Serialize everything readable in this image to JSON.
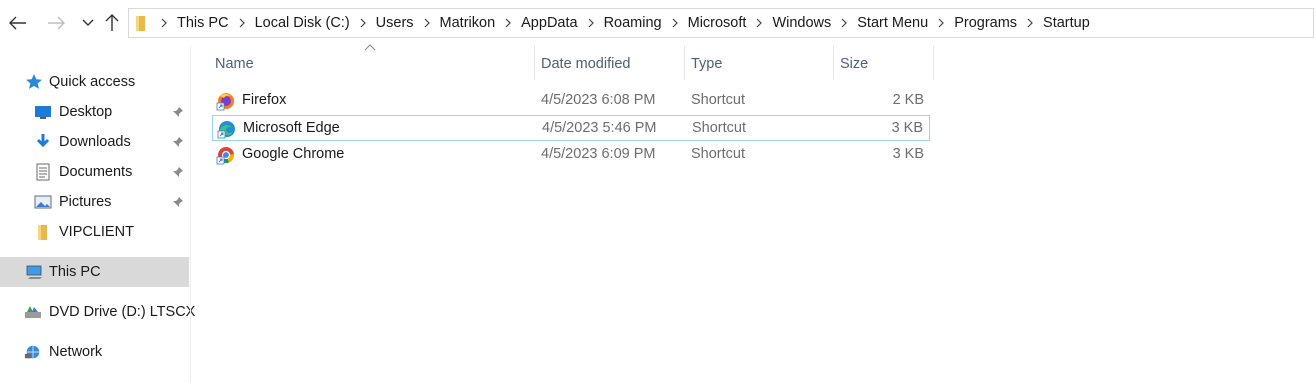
{
  "toolbar": {
    "back_icon": "arrow-left-icon",
    "forward_icon": "arrow-right-icon",
    "recent_icon": "chevron-down-icon",
    "up_icon": "arrow-up-icon"
  },
  "breadcrumb": {
    "items": [
      "This PC",
      "Local Disk (C:)",
      "Users",
      "Matrikon",
      "AppData",
      "Roaming",
      "Microsoft",
      "Windows",
      "Start Menu",
      "Programs",
      "Startup"
    ]
  },
  "sidebar": {
    "items": [
      {
        "label": "Quick access",
        "icon": "star-icon",
        "pinned": false
      },
      {
        "label": "Desktop",
        "icon": "desktop-icon",
        "pinned": true
      },
      {
        "label": "Downloads",
        "icon": "download-icon",
        "pinned": true
      },
      {
        "label": "Documents",
        "icon": "documents-icon",
        "pinned": true
      },
      {
        "label": "Pictures",
        "icon": "pictures-icon",
        "pinned": true
      },
      {
        "label": "VIPCLIENT",
        "icon": "folder-icon",
        "pinned": false
      },
      {
        "label": "This PC",
        "icon": "computer-icon",
        "pinned": false,
        "selected": true
      },
      {
        "label": "DVD Drive (D:) LTSCX",
        "icon": "dvd-drive-icon",
        "pinned": false
      },
      {
        "label": "Network",
        "icon": "network-icon",
        "pinned": false
      }
    ]
  },
  "columns": {
    "name": "Name",
    "date": "Date modified",
    "type": "Type",
    "size": "Size"
  },
  "files": [
    {
      "name": "Firefox",
      "date": "4/5/2023 6:08 PM",
      "type": "Shortcut",
      "size": "2 KB",
      "icon": "firefox-icon"
    },
    {
      "name": "Microsoft Edge",
      "date": "4/5/2023 5:46 PM",
      "type": "Shortcut",
      "size": "3 KB",
      "icon": "edge-icon",
      "selected": true
    },
    {
      "name": "Google Chrome",
      "date": "4/5/2023 6:09 PM",
      "type": "Shortcut",
      "size": "3 KB",
      "icon": "chrome-icon"
    }
  ],
  "colors": {
    "selection_border": "#99d1ff",
    "sidebar_selected": "#d9d9d9",
    "header_text": "#4c607a"
  }
}
